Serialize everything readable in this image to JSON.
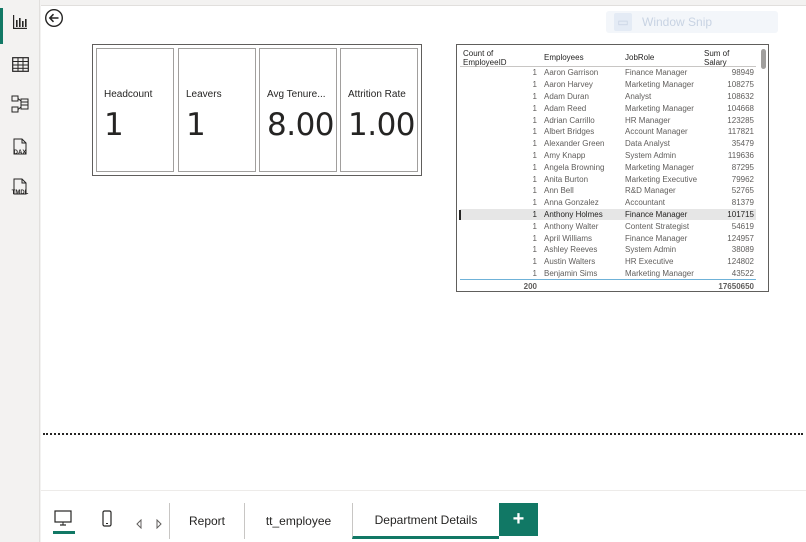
{
  "rail": {
    "items": [
      {
        "name": "report-view-icon"
      },
      {
        "name": "table-view-icon"
      },
      {
        "name": "model-view-icon"
      },
      {
        "name": "dax-query-view-icon",
        "text": "DAX"
      },
      {
        "name": "tmdl-view-icon",
        "text": "TMDL"
      }
    ]
  },
  "toolbar": {
    "ghost_label": "Window Snip"
  },
  "cards": [
    {
      "label": "Headcount",
      "value": "1"
    },
    {
      "label": "Leavers",
      "value": "1"
    },
    {
      "label": "Avg Tenure...",
      "value": "8.00"
    },
    {
      "label": "Attrition Rate",
      "value": "1.00"
    }
  ],
  "table": {
    "headers": [
      "Count of EmployeeID",
      "Employees",
      "JobRole",
      "Sum of Salary"
    ],
    "rows": [
      [
        "1",
        "Aaron Garrison",
        "Finance Manager",
        "98949"
      ],
      [
        "1",
        "Aaron Harvey",
        "Marketing Manager",
        "108275"
      ],
      [
        "1",
        "Adam Duran",
        "Analyst",
        "108632"
      ],
      [
        "1",
        "Adam Reed",
        "Marketing Manager",
        "104668"
      ],
      [
        "1",
        "Adrian Carrillo",
        "HR Manager",
        "123285"
      ],
      [
        "1",
        "Albert Bridges",
        "Account Manager",
        "117821"
      ],
      [
        "1",
        "Alexander Green",
        "Data Analyst",
        "35479"
      ],
      [
        "1",
        "Amy Knapp",
        "System Admin",
        "119636"
      ],
      [
        "1",
        "Angela Browning",
        "Marketing Manager",
        "87295"
      ],
      [
        "1",
        "Anita Burton",
        "Marketing Executive",
        "79962"
      ],
      [
        "1",
        "Ann Bell",
        "R&D Manager",
        "52765"
      ],
      [
        "1",
        "Anna Gonzalez",
        "Accountant",
        "81379"
      ],
      [
        "1",
        "Anthony Holmes",
        "Finance Manager",
        "101715"
      ],
      [
        "1",
        "Anthony Walter",
        "Content Strategist",
        "54619"
      ],
      [
        "1",
        "April Williams",
        "Finance Manager",
        "124957"
      ],
      [
        "1",
        "Ashley Reeves",
        "System Admin",
        "38089"
      ],
      [
        "1",
        "Austin Walters",
        "HR Executive",
        "124802"
      ],
      [
        "1",
        "Benjamin Sims",
        "Marketing Manager",
        "43522"
      ]
    ],
    "highlighted_row": 12,
    "totals": [
      "200",
      "",
      "",
      "17650650"
    ]
  },
  "bottom": {
    "tabs": [
      "Report",
      "tt_employee",
      "Department Details"
    ],
    "active_tab": "Department Details",
    "add_label": "+"
  },
  "colors": {
    "accent": "#117865"
  }
}
